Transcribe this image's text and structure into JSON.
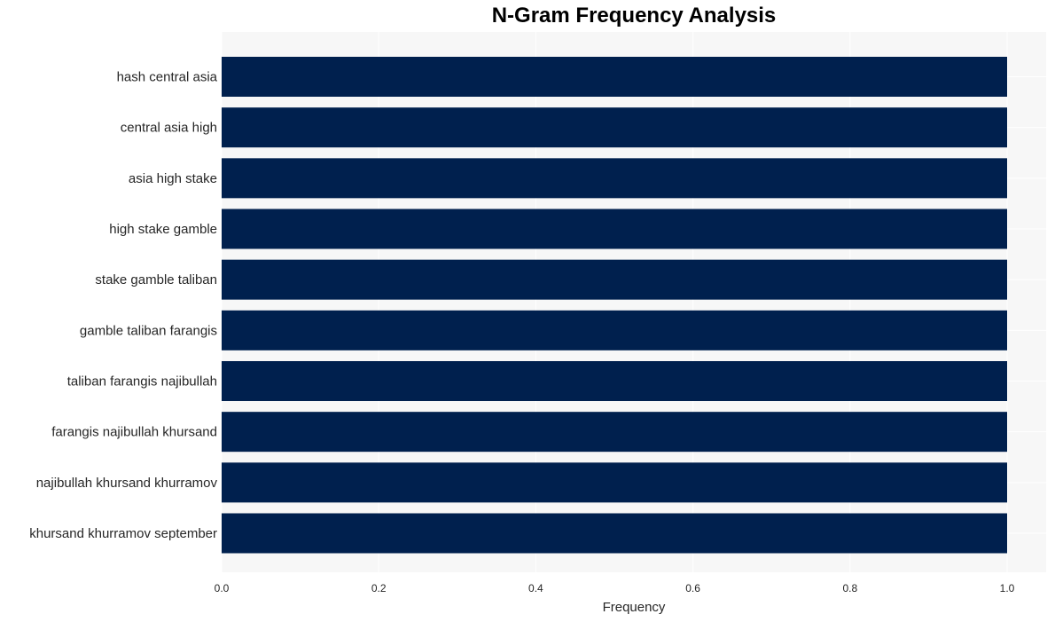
{
  "chart_data": {
    "type": "bar",
    "orientation": "horizontal",
    "title": "N-Gram Frequency Analysis",
    "xlabel": "Frequency",
    "ylabel": "",
    "xlim": [
      0,
      1.05
    ],
    "xticks": [
      0.0,
      0.2,
      0.4,
      0.6,
      0.8,
      1.0
    ],
    "xtick_labels": [
      "0.0",
      "0.2",
      "0.4",
      "0.6",
      "0.8",
      "1.0"
    ],
    "grid": true,
    "categories": [
      "hash central asia",
      "central asia high",
      "asia high stake",
      "high stake gamble",
      "stake gamble taliban",
      "gamble taliban farangis",
      "taliban farangis najibullah",
      "farangis najibullah khursand",
      "najibullah khursand khurramov",
      "khursand khurramov september"
    ],
    "values": [
      1,
      1,
      1,
      1,
      1,
      1,
      1,
      1,
      1,
      1
    ],
    "bar_color": "#00204e",
    "background_color": "#f7f7f7"
  }
}
